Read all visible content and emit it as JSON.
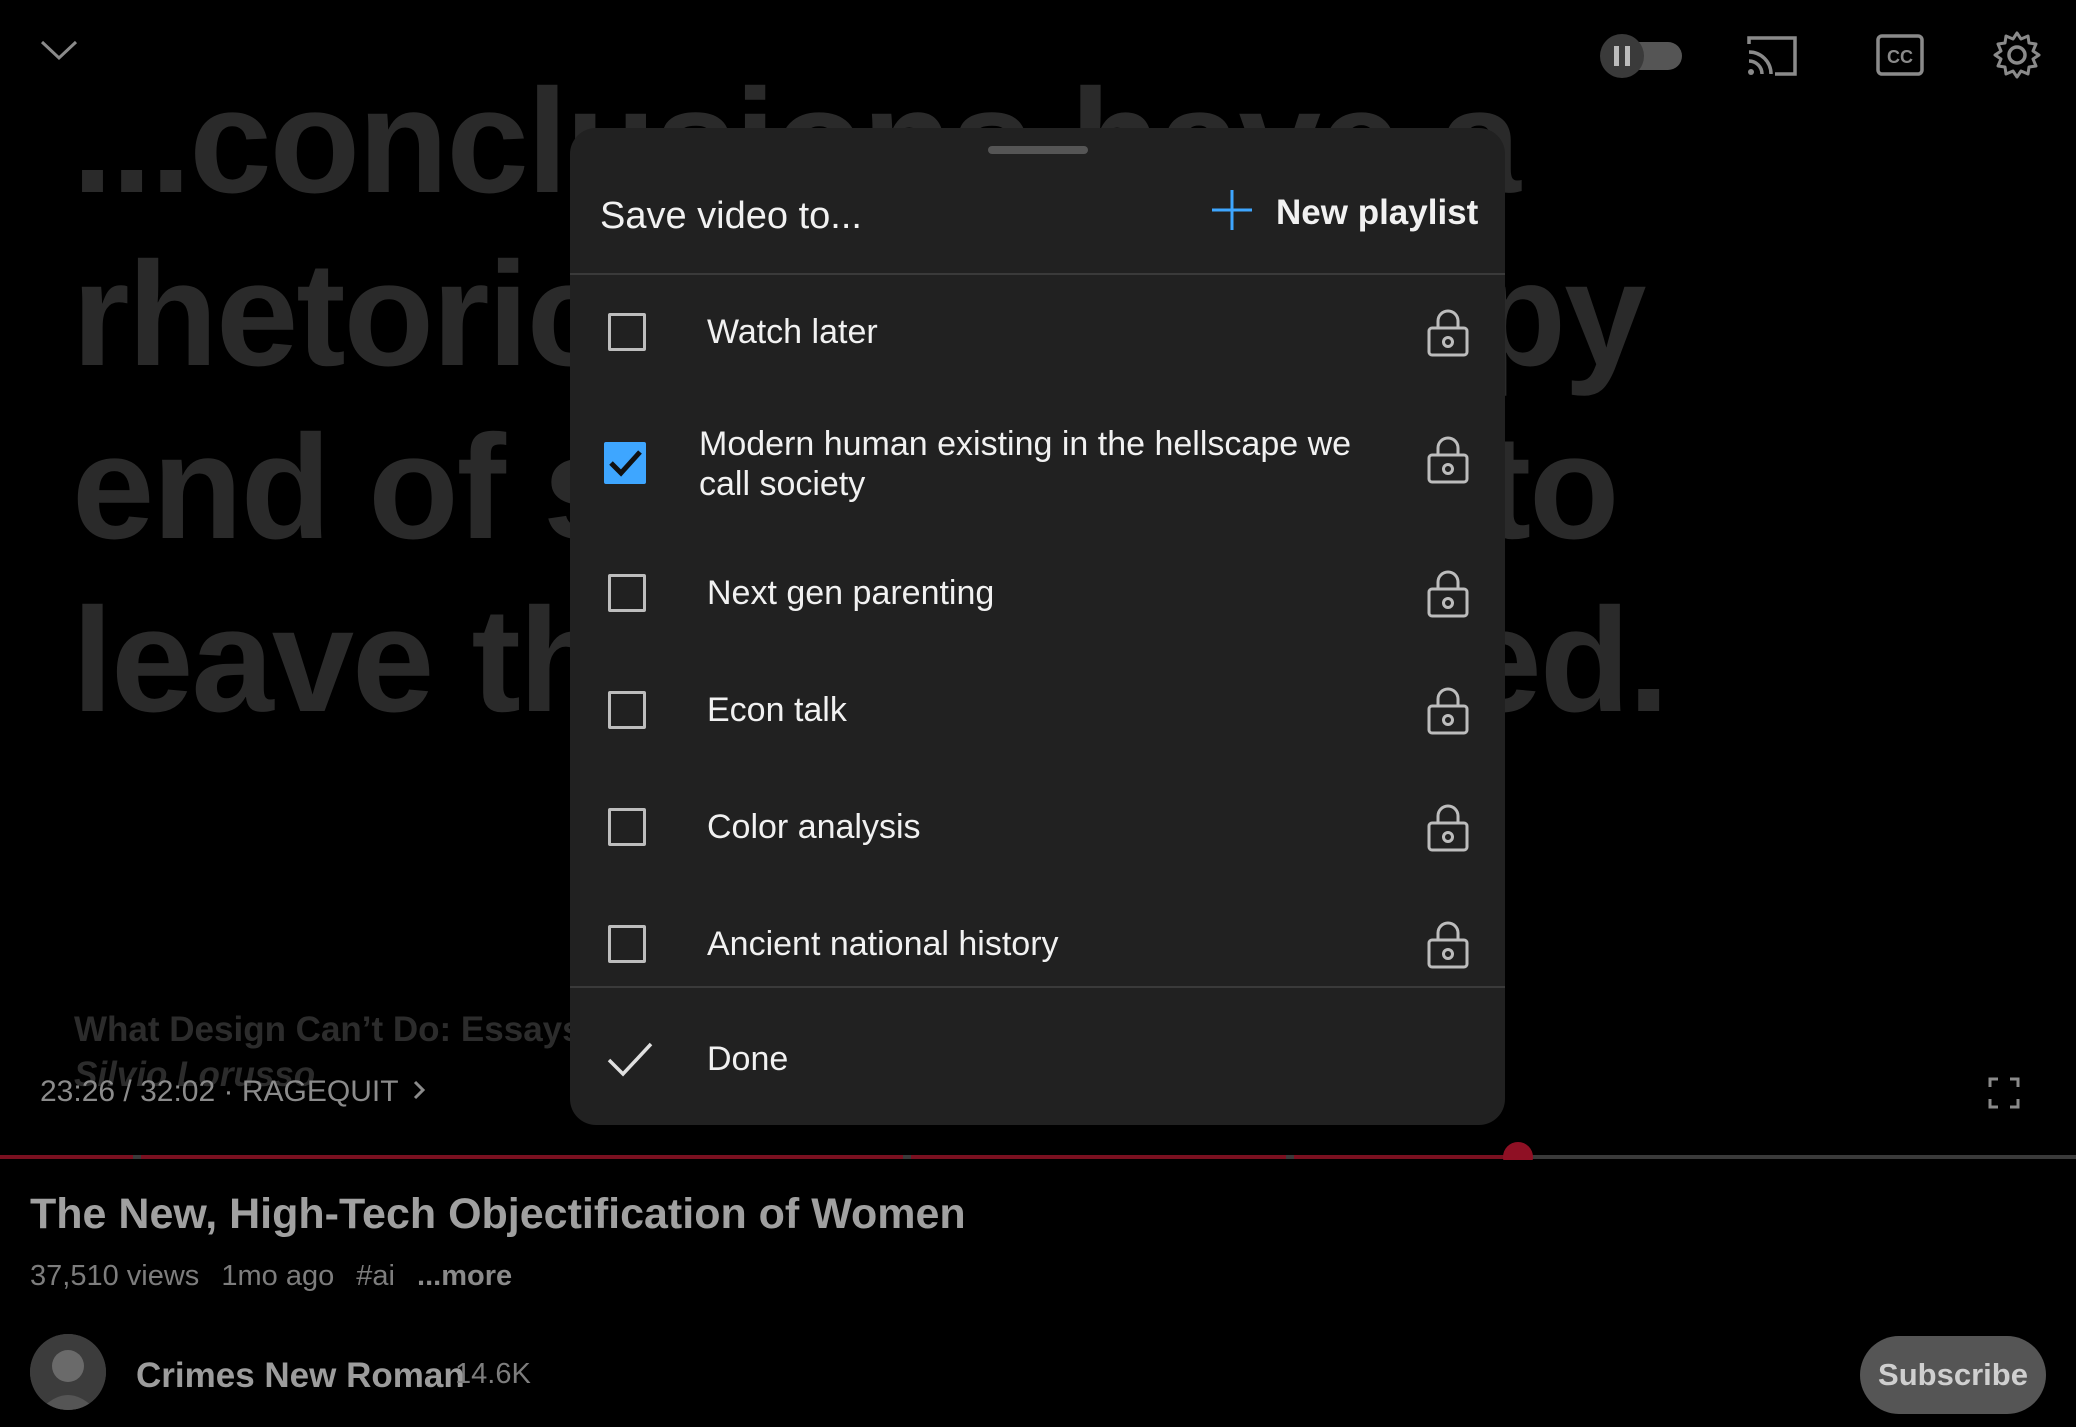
{
  "video": {
    "slide_lines": [
      "...conclusions have a",
      "rhetoric",
      "end of so",
      "leave the"
    ],
    "slide_lines_right": [
      "",
      "appy",
      "to",
      "zed."
    ],
    "book_title": "What Design Can’t Do: Essays on",
    "book_author": "Silvio Lorusso",
    "time": "23:26 / 32:02",
    "chapter_sep": "·",
    "chapter": "RAGEQUIT",
    "progress": {
      "position_fraction": 0.731,
      "color": "#7a1020"
    }
  },
  "player_icons": [
    "chevron-down-icon",
    "autoplay-toggle-icon",
    "cast-icon",
    "captions-icon",
    "settings-gear-icon",
    "fullscreen-icon"
  ],
  "info": {
    "title": "The New, High-Tech Objectification of Women",
    "views": "37,510 views",
    "age": "1mo ago",
    "hashtag": "#ai",
    "more": "...more",
    "channel": "Crimes New Roman",
    "subscribers": "14.6K",
    "subscribe_label": "Subscribe"
  },
  "dialog": {
    "title": "Save video to...",
    "new_playlist_label": "New playlist",
    "accent": "#3ea6ff",
    "playlists": [
      {
        "name": "Watch later",
        "checked": false,
        "privacy": "private"
      },
      {
        "name": "Modern human existing in the hellscape we call society",
        "checked": true,
        "privacy": "private"
      },
      {
        "name": "Next gen parenting",
        "checked": false,
        "privacy": "private"
      },
      {
        "name": "Econ talk",
        "checked": false,
        "privacy": "private"
      },
      {
        "name": "Color analysis",
        "checked": false,
        "privacy": "private"
      },
      {
        "name": "Ancient national history",
        "checked": false,
        "privacy": "private"
      }
    ],
    "done_label": "Done"
  }
}
